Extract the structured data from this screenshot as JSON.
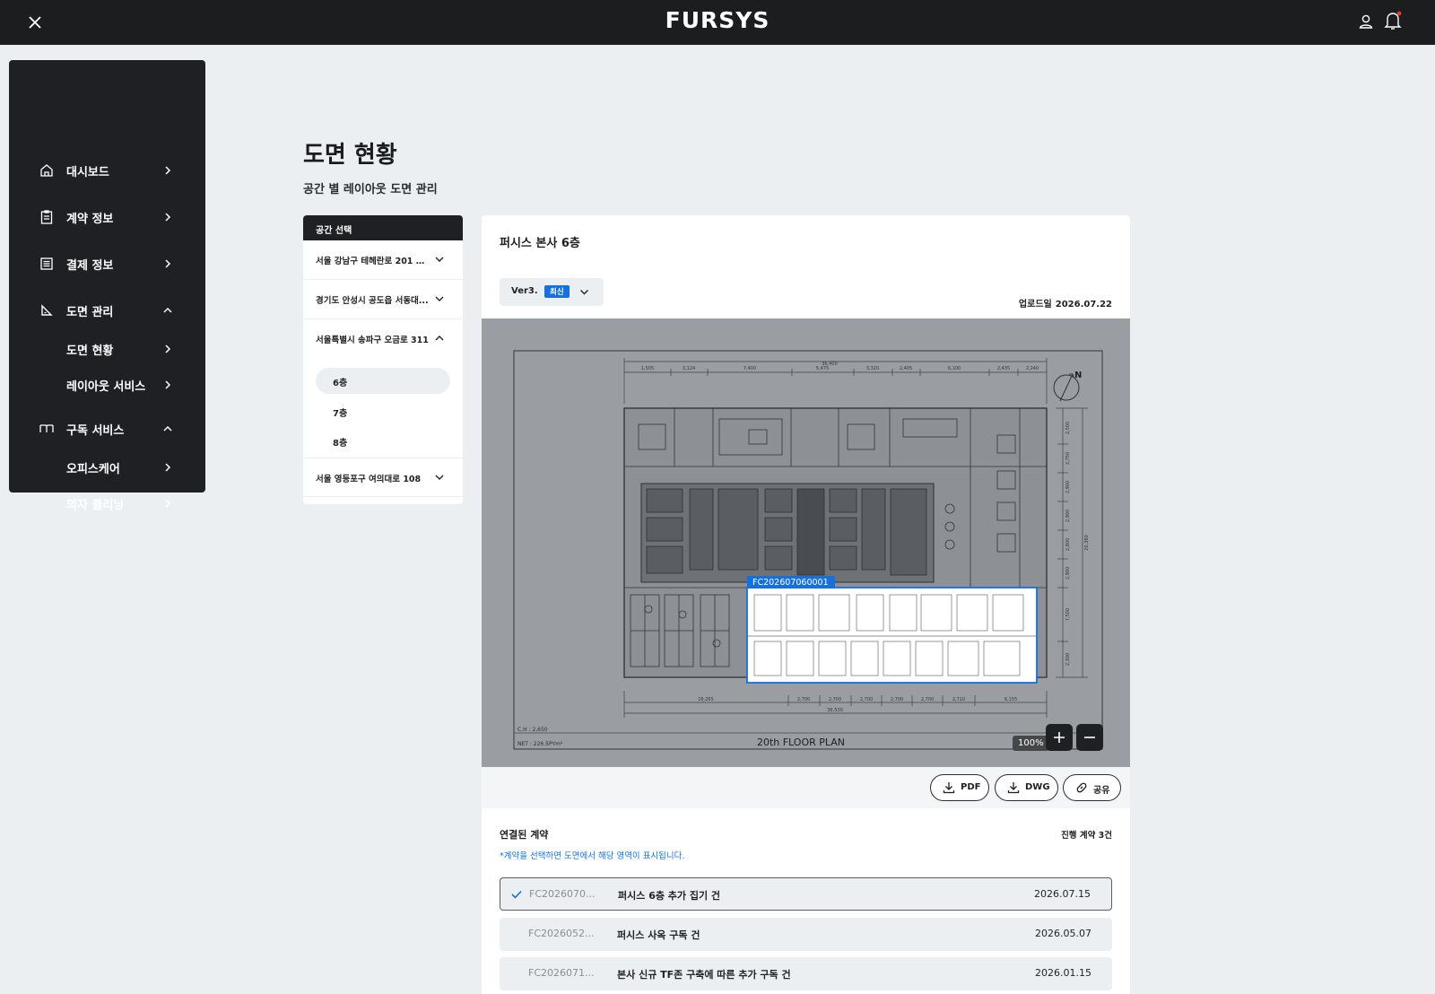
{
  "app": {
    "brand": "FURSYS"
  },
  "topbar": {
    "close_icon": "close-icon",
    "user_icon": "user-icon",
    "bell_icon": "bell-icon",
    "notification_dot_color": "#e53935"
  },
  "sidebar": {
    "items": [
      {
        "label": "대시보드",
        "icon": "home-icon",
        "state": "collapsed"
      },
      {
        "label": "계약 정보",
        "icon": "clipboard-icon",
        "state": "collapsed"
      },
      {
        "label": "결제 정보",
        "icon": "receipt-icon",
        "state": "collapsed"
      },
      {
        "label": "도면 관리",
        "icon": "set-square-icon",
        "state": "expanded"
      },
      {
        "label": "도면 현황",
        "sub": true
      },
      {
        "label": "레이아웃 서비스",
        "sub": true
      },
      {
        "label": "구독 서비스",
        "icon": "book-icon",
        "state": "expanded"
      },
      {
        "label": "오피스케어",
        "sub": true
      },
      {
        "label": "의자 클리닝",
        "sub": true
      }
    ]
  },
  "page": {
    "title": "도면 현황",
    "subtitle": "공간 별 레이아웃 도면 관리"
  },
  "space_selector": {
    "header": "공간 선택",
    "spaces": [
      {
        "label": "서울 강남구 테헤란로 201 아...",
        "expanded": false
      },
      {
        "label": "경기도 안성시 공도읍 서동대...",
        "expanded": false
      },
      {
        "label": "서울특별시 송파구 오금로 311",
        "expanded": true
      },
      {
        "label": "서울 영등포구 여의대로 108",
        "expanded": false
      }
    ],
    "floors": [
      "6층",
      "7층",
      "8층"
    ],
    "selected_floor": "6층"
  },
  "plan": {
    "title": "퍼시스 본사 6층",
    "version": "Ver3.",
    "version_badge": "최신",
    "upload_label": "업로드일",
    "upload_date": "2026.07.22",
    "highlight_label": "FC202607060001",
    "highlight_color": "#1570dd",
    "drawing_title": "20th FLOOR PLAN",
    "ch_note": "C.H : 2,650",
    "net_note": "NET : 226.5PYm²",
    "zoom": "100%",
    "dim_top": [
      "1,505",
      "3,124",
      "7,400",
      "5,475",
      "3,320",
      "2,405",
      "6,100",
      "2,435",
      "2,240"
    ],
    "dim_total": "36,400",
    "dim_bottom": [
      "16,265",
      "2,700",
      "2,700",
      "2,700",
      "2,700",
      "2,700",
      "2,710",
      "6,155"
    ],
    "dim_bottom_total": "36,530",
    "dim_right": [
      "2,500",
      "2,750",
      "2,900",
      "2,900",
      "2,800",
      "2,900",
      "7,500",
      "2,300"
    ],
    "dim_right_total": "20,380"
  },
  "actions": {
    "pdf": "PDF",
    "dwg": "DWG",
    "share": "공유"
  },
  "linked": {
    "title": "연결된 계약",
    "count": "진행 계약 3건",
    "note": "*계약을 선택하면 도면에서 해당 영역이 표시됩니다.",
    "contracts": [
      {
        "id": "FC2026070...",
        "name": "퍼시스 6층 추가 집기 건",
        "date": "2026.07.15",
        "selected": true
      },
      {
        "id": "FC2026052...",
        "name": "퍼시스 사옥 구독 건",
        "date": "2026.05.07",
        "selected": false
      },
      {
        "id": "FC2026071...",
        "name": "본사 신규 TF존 구축에 따른 추가 구독 건",
        "date": "2026.01.15",
        "selected": false
      }
    ]
  }
}
